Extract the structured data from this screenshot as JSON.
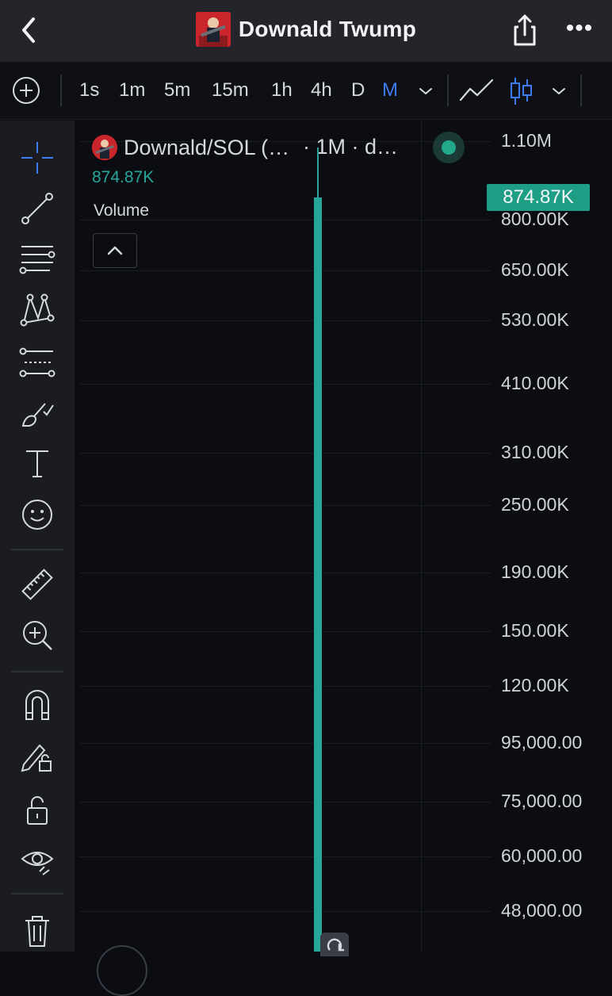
{
  "header": {
    "title": "Downald Twump",
    "more_label": "•••"
  },
  "toolbar": {
    "intervals": [
      "1s",
      "1m",
      "5m",
      "15m",
      "1h",
      "4h",
      "D",
      "M"
    ],
    "active_interval": "M"
  },
  "chart_info": {
    "symbol": "Downald/SOL (…",
    "interval_desc": "· 1M · d…",
    "last_value": "874.87K",
    "indicator_label": "Volume"
  },
  "chart_data": {
    "type": "bar",
    "scale": "log",
    "series": [
      {
        "values": [
          874870
        ]
      }
    ],
    "y_tick_labels": [
      "1.10M",
      "800.00K",
      "650.00K",
      "530.00K",
      "410.00K",
      "310.00K",
      "250.00K",
      "190.00K",
      "150.00K",
      "120.00K",
      "95,000.00",
      "75,000.00",
      "60,000.00",
      "48,000.00"
    ],
    "y_ticks": [
      1100000,
      800000,
      650000,
      530000,
      410000,
      310000,
      250000,
      190000,
      150000,
      120000,
      95000,
      75000,
      60000,
      48000
    ],
    "current_value_label": "874.87K",
    "current_value": 874870,
    "wick_high": 1100000,
    "color": "#26a69a"
  },
  "colors": {
    "accent": "#3f7cf4",
    "up": "#26a69a",
    "brand_red": "#c8262b"
  }
}
